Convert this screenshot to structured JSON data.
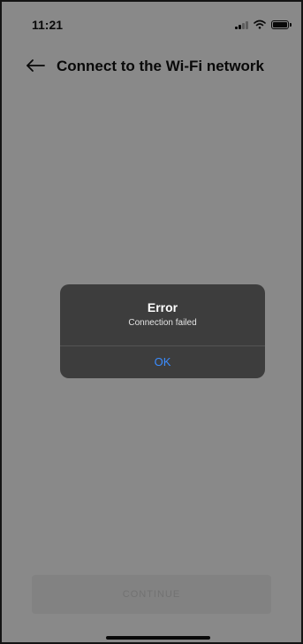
{
  "status_bar": {
    "time": "11:21",
    "icons": [
      "signal-icon",
      "wifi-icon",
      "battery-icon"
    ]
  },
  "header": {
    "back_icon": "back-arrow-icon",
    "title": "Connect to the Wi-Fi network"
  },
  "bottom_button": {
    "label": "CONTINUE"
  },
  "alert": {
    "title": "Error",
    "message": "Connection failed",
    "ok_label": "OK",
    "ok_color": "#3b8cff",
    "background_color": "#3d3d3d"
  },
  "colors": {
    "overlay": "rgba(0,0,0,0.45)",
    "text": "#111111"
  }
}
